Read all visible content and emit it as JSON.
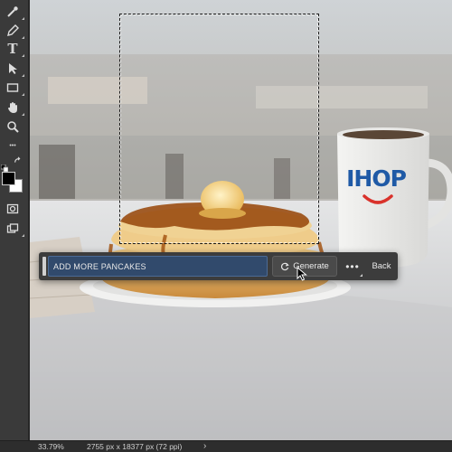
{
  "toolbar": {
    "tools": [
      {
        "name": "magic-wand-icon"
      },
      {
        "name": "pen-icon"
      },
      {
        "name": "type-icon",
        "glyph": "T"
      },
      {
        "name": "move-arrow-icon"
      },
      {
        "name": "rectangle-icon"
      },
      {
        "name": "hand-icon"
      },
      {
        "name": "zoom-icon"
      },
      {
        "name": "more-tools-icon",
        "glyph": "•••"
      },
      {
        "name": "swap-colors-icon"
      },
      {
        "name": "quick-mask-icon"
      },
      {
        "name": "screen-mode-icon"
      }
    ],
    "foreground_color": "#000000",
    "background_color": "#ffffff"
  },
  "photo": {
    "mug_logo_text": "IHOP",
    "mug_logo_color": "#1f5aa6",
    "smile_color": "#d9322b"
  },
  "taskbar": {
    "prompt_value": "ADD MORE PANCAKES",
    "generate_label": "Generate",
    "more_label": "•••",
    "back_label": "Back"
  },
  "status": {
    "zoom": "33.79%",
    "dimensions": "2755 px x 18377 px (72 ppi)",
    "arrow": "›"
  },
  "colors": {
    "accent_input": "#314a6c",
    "panel": "#3c3c3c"
  }
}
